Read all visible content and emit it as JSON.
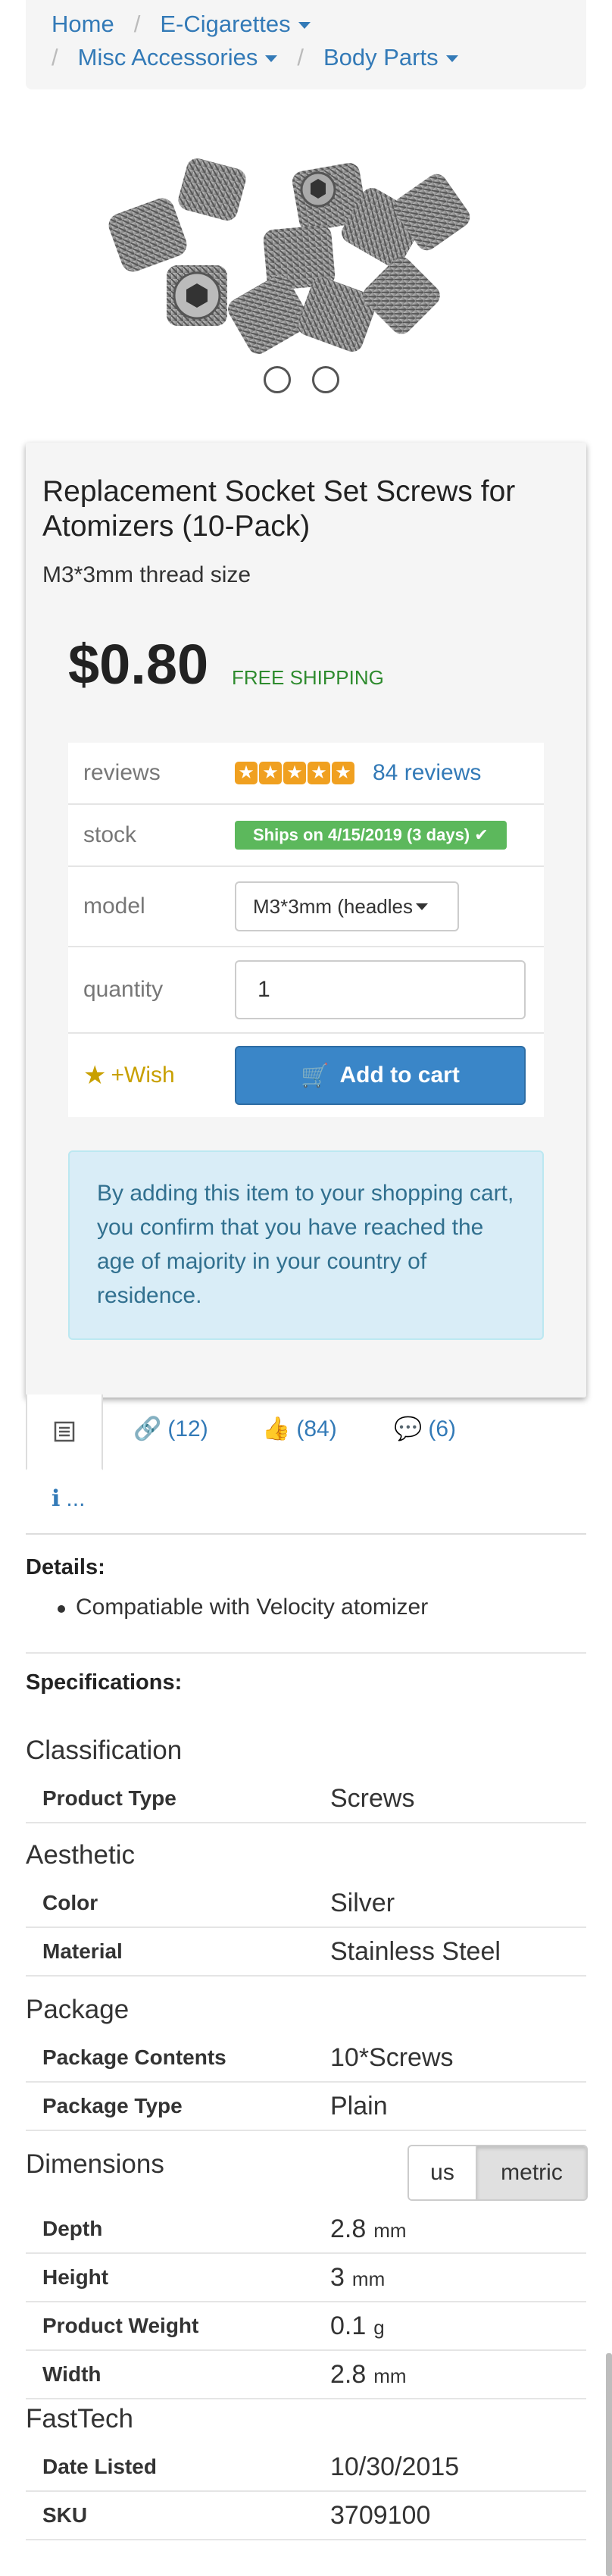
{
  "breadcrumb": {
    "home": "Home",
    "ecig": "E-Cigarettes",
    "misc": "Misc Accessories",
    "body": "Body Parts",
    "separator": "/"
  },
  "product": {
    "title": "Replacement Socket Set Screws for Atomizers (10-Pack)",
    "subtitle": "M3*3mm thread size",
    "price": "$0.80",
    "shipping": "FREE SHIPPING",
    "rating_stars": 5,
    "reviews_label": "reviews",
    "reviews_link": "84 reviews",
    "stock_label": "stock",
    "stock_badge": "Ships on 4/15/2019 (3 days) ✔",
    "model_label": "model",
    "model_value": "M3*3mm (headles",
    "quantity_label": "quantity",
    "quantity_value": "1",
    "wish_label": "+Wish",
    "cart_label": "Add to cart",
    "notice": "By adding this item to your shopping cart, you confirm that you have reached the age of majority in your country of residence."
  },
  "tabs": {
    "links": "(12)",
    "likes": "(84)",
    "comments": "(6)",
    "info": "..."
  },
  "details": {
    "label": "Details:",
    "bullets": [
      "Compatiable with Velocity atomizer"
    ]
  },
  "specs": {
    "label": "Specifications:",
    "classification": {
      "title": "Classification",
      "product_type_key": "Product Type",
      "product_type_val": "Screws"
    },
    "aesthetic": {
      "title": "Aesthetic",
      "color_key": "Color",
      "color_val": "Silver",
      "material_key": "Material",
      "material_val": "Stainless Steel"
    },
    "package": {
      "title": "Package",
      "contents_key": "Package Contents",
      "contents_val": "10*Screws",
      "type_key": "Package Type",
      "type_val": "Plain"
    },
    "dimensions": {
      "title": "Dimensions",
      "toggle_us": "us",
      "toggle_metric": "metric",
      "depth_key": "Depth",
      "depth_val": "2.8",
      "depth_unit": "mm",
      "height_key": "Height",
      "height_val": "3",
      "height_unit": "mm",
      "weight_key": "Product Weight",
      "weight_val": "0.1",
      "weight_unit": "g",
      "width_key": "Width",
      "width_val": "2.8",
      "width_unit": "mm"
    },
    "fasttech": {
      "title": "FastTech",
      "date_key": "Date Listed",
      "date_val": "10/30/2015",
      "sku_key": "SKU",
      "sku_val": "3709100"
    }
  },
  "colors": {
    "link": "#337ab7",
    "success": "#5cb85c",
    "primary_button": "#3a86c8",
    "info_bg": "#d9edf7",
    "wish": "#c8a000"
  }
}
